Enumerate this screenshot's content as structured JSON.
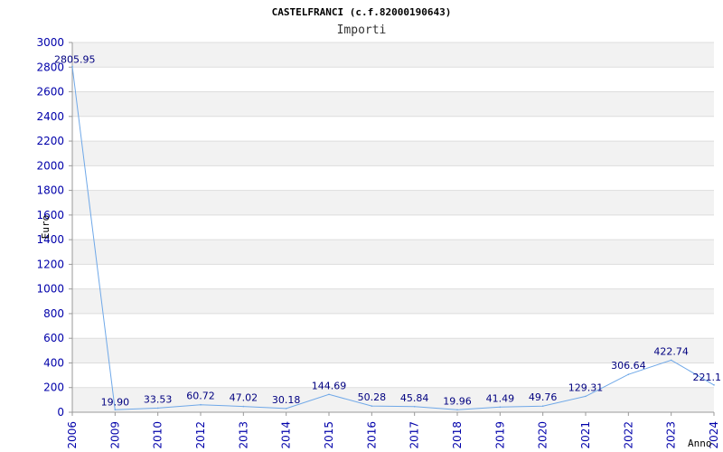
{
  "header": {
    "title": "CASTELFRANCI (c.f.82000190643)"
  },
  "chart_data": {
    "type": "line",
    "title": "CASTELFRANCI (c.f.82000190643)",
    "subtitle": "Importi",
    "xlabel": "Anno",
    "ylabel": "Euro",
    "ylim": [
      0,
      3000
    ],
    "yticks": [
      "0",
      "200",
      "400",
      "600",
      "800",
      "1000",
      "1200",
      "1400",
      "1600",
      "1800",
      "2000",
      "2200",
      "2400",
      "2600",
      "2800",
      "3000"
    ],
    "categories": [
      "2006",
      "2009",
      "2010",
      "2012",
      "2013",
      "2014",
      "2015",
      "2016",
      "2017",
      "2018",
      "2019",
      "2020",
      "2021",
      "2022",
      "2023",
      "2024"
    ],
    "series": [
      {
        "values": [
          2805.95,
          19.9,
          33.53,
          60.72,
          47.02,
          30.18,
          144.69,
          50.28,
          45.84,
          19.96,
          41.49,
          49.76,
          129.31,
          306.64,
          422.74,
          221.1
        ],
        "labels": [
          "2805.95",
          "19.90",
          "33.53",
          "60.72",
          "47.02",
          "30.18",
          "144.69",
          "50.28",
          "45.84",
          "19.96",
          "41.49",
          "49.76",
          "129.31",
          "306.64",
          "422.74",
          "221.1"
        ]
      }
    ],
    "grid": true,
    "colors": {
      "line": "#6fa8e8",
      "band": "#f2f2f2",
      "axis_text": "#0000aa",
      "title_text": "#000000"
    }
  }
}
